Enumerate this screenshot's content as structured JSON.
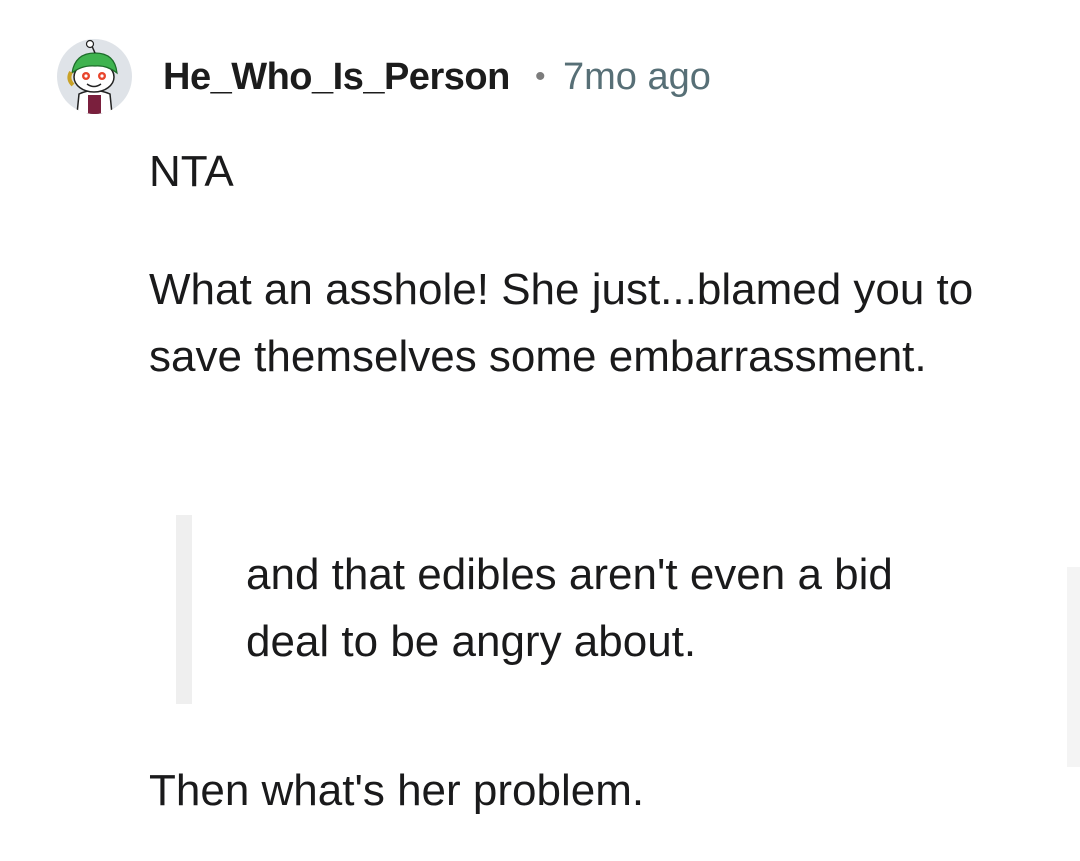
{
  "comment": {
    "author": "He_Who_Is_Person",
    "separator": "•",
    "timestamp": "7mo ago",
    "paragraphs": {
      "verdict": "NTA",
      "main": "What an asshole! She just...blamed you to save themselves some embarrassment.",
      "closing": "Then what's her problem."
    },
    "quote": "and that edibles aren't even a bid deal to be angry about."
  },
  "icons": {
    "avatar": "snoo-avatar-icon"
  },
  "colors": {
    "text": "#1a1a1b",
    "timestamp": "#576f76",
    "quote_bar": "#efefef",
    "avatar_bg": "#dfe3e8",
    "avatar_hat": "#3fb34f"
  }
}
